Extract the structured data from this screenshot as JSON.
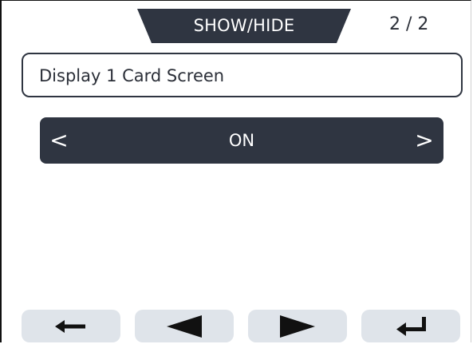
{
  "header": {
    "title": "SHOW/HIDE",
    "page_indicator": "2 / 2"
  },
  "setting": {
    "name": "Display 1 Card Screen"
  },
  "selector": {
    "prev_label": "<",
    "value": "ON",
    "next_label": ">"
  },
  "colors": {
    "dark": "#2f3541",
    "button_bg": "#dfe4ea"
  },
  "buttons": [
    {
      "icon": "back-arrow-icon"
    },
    {
      "icon": "triangle-left-icon"
    },
    {
      "icon": "triangle-right-icon"
    },
    {
      "icon": "enter-return-icon"
    }
  ]
}
